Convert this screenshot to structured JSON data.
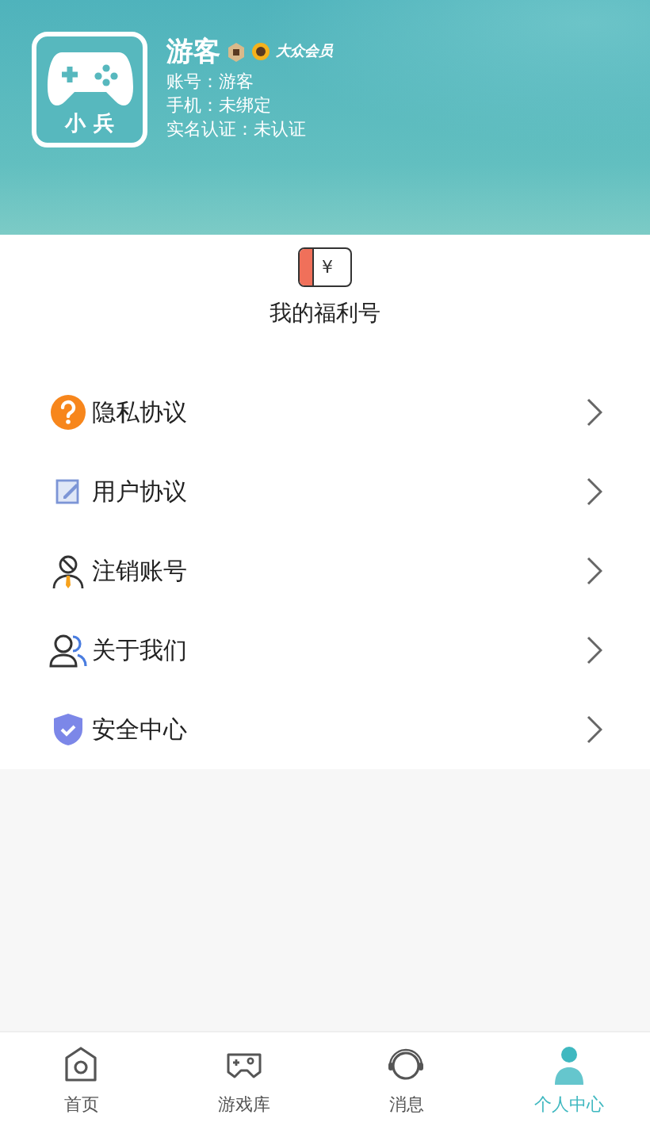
{
  "profile": {
    "avatar_label": "小 兵",
    "name": "游客",
    "badge": "大众会员",
    "lines": [
      "账号：游客",
      "手机：未绑定",
      "实名认证：未认证"
    ]
  },
  "welfare": {
    "label": "我的福利号",
    "icon_text": "¥"
  },
  "menu": [
    {
      "kind": "privacy",
      "label": "隐私协议"
    },
    {
      "kind": "agreement",
      "label": "用户协议"
    },
    {
      "kind": "cancel",
      "label": "注销账号"
    },
    {
      "kind": "about",
      "label": "关于我们"
    },
    {
      "kind": "security",
      "label": "安全中心"
    }
  ],
  "tabs": [
    {
      "kind": "home",
      "label": "首页",
      "selected": false
    },
    {
      "kind": "games",
      "label": "游戏库",
      "selected": false
    },
    {
      "kind": "messages",
      "label": "消息",
      "selected": false
    },
    {
      "kind": "profile",
      "label": "个人中心",
      "selected": true
    }
  ]
}
